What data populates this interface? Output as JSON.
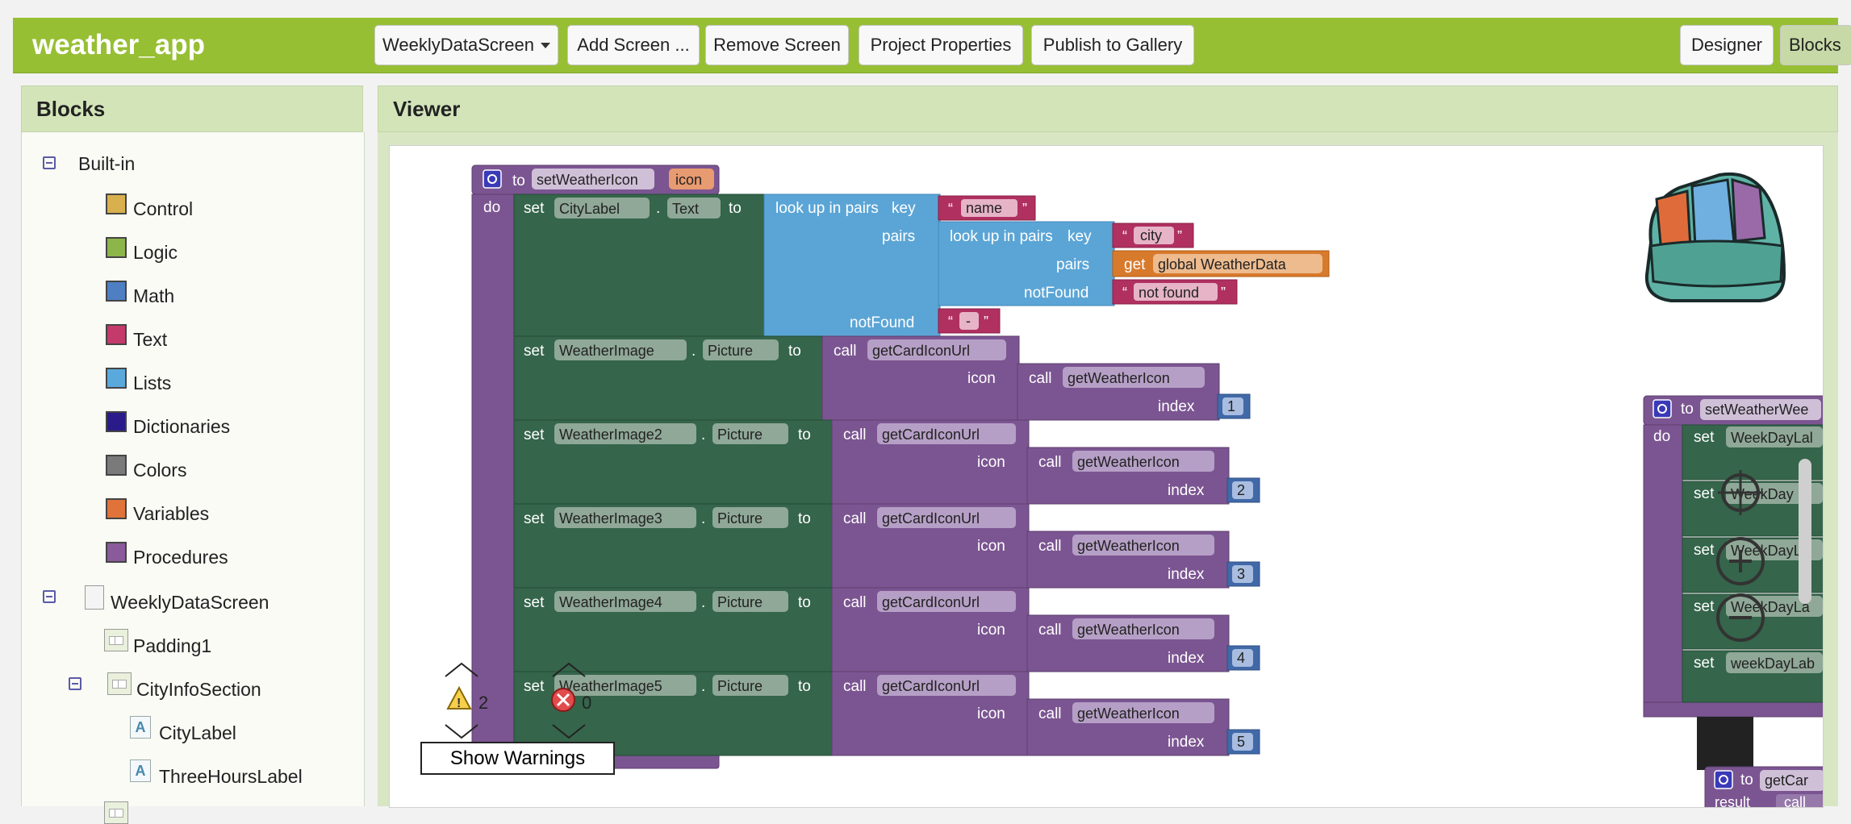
{
  "app": {
    "title": "weather_app"
  },
  "toolbar": {
    "screen_select": "WeeklyDataScreen",
    "add_screen": "Add Screen ...",
    "remove_screen": "Remove Screen",
    "project_properties": "Project Properties",
    "publish": "Publish to Gallery",
    "designer": "Designer",
    "blocks": "Blocks"
  },
  "blocks_panel": {
    "title": "Blocks",
    "builtin": "Built-in",
    "categories": [
      {
        "label": "Control",
        "color": "#d9b04e"
      },
      {
        "label": "Logic",
        "color": "#8cb54a"
      },
      {
        "label": "Math",
        "color": "#4e7fc2"
      },
      {
        "label": "Text",
        "color": "#c43a6a"
      },
      {
        "label": "Lists",
        "color": "#5aa9dc"
      },
      {
        "label": "Dictionaries",
        "color": "#2a1b8a"
      },
      {
        "label": "Colors",
        "color": "#7a7a7a"
      },
      {
        "label": "Variables",
        "color": "#e0733a"
      },
      {
        "label": "Procedures",
        "color": "#8a5a9a"
      }
    ],
    "screen": "WeeklyDataScreen",
    "components": [
      "Padding1",
      "CityInfoSection",
      "CityLabel",
      "ThreeHoursLabel"
    ]
  },
  "viewer": {
    "title": "Viewer",
    "show_warnings": "Show Warnings",
    "warnings_count": "2",
    "errors_count": "0"
  },
  "blocks": {
    "proc_to": "to",
    "proc_name": "setWeatherIcon",
    "param": "icon",
    "do": "do",
    "set": "set",
    "dot": ".",
    "to": "to",
    "call": "call",
    "get": "get",
    "city_label": "CityLabel",
    "text_prop": "Text",
    "lookup": "look up in pairs",
    "key": "key",
    "pairs": "pairs",
    "notfound": "notFound",
    "name_str": "name",
    "city_str": "city",
    "global_var": "global WeatherData",
    "notfound_str": "not found",
    "dash_str": "-",
    "picture_prop": "Picture",
    "get_card": "getCardIconUrl",
    "get_weather": "getWeatherIcon",
    "icon_lbl": "icon",
    "index_lbl": "index",
    "rows": [
      {
        "comp": "WeatherImage",
        "index": "1"
      },
      {
        "comp": "WeatherImage2",
        "index": "2"
      },
      {
        "comp": "WeatherImage3",
        "index": "3"
      },
      {
        "comp": "WeatherImage4",
        "index": "4"
      },
      {
        "comp": "WeatherImage5",
        "index": "5"
      }
    ],
    "right_proc": "setWeatherWee",
    "right_sets": [
      "WeekDayLal",
      "WeekDay",
      "WeekDayLa",
      "WeekDayLa",
      "weekDayLab"
    ],
    "bottom_proc": "getCar",
    "result": "result",
    "bottom_call": "call"
  },
  "colors": {
    "topbar": "#97bf34",
    "procedure": "#7b5591",
    "component_set": "#35654b",
    "lists": "#5ba5d6",
    "text": "#b03060",
    "variable": "#d87a2c",
    "math": "#4169a8"
  }
}
